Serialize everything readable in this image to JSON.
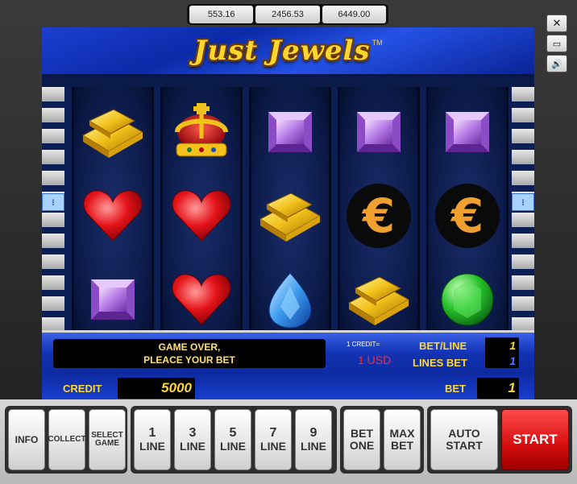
{
  "jackpots": [
    "553.16",
    "2456.53",
    "6449.00"
  ],
  "side_controls": {
    "close": "✕",
    "window": "▭",
    "sound": "🔊"
  },
  "game": {
    "title": "Just Jewels",
    "trademark": "TM",
    "line_indicator": "⁝",
    "reels": [
      [
        "gold-bars",
        "heart",
        "amethyst"
      ],
      [
        "crown",
        "heart",
        "heart"
      ],
      [
        "amethyst",
        "gold-bars",
        "sapphire"
      ],
      [
        "amethyst",
        "euro",
        "gold-bars"
      ],
      [
        "amethyst",
        "euro",
        "emerald"
      ]
    ]
  },
  "panel": {
    "message_line1": "GAME OVER,",
    "message_line2": "PLEACE YOUR BET",
    "credit_rate_label": "1 CREDIT=",
    "credit_rate_value": "1 USD",
    "bet_line_label": "BET/LINE",
    "bet_line_value": "1",
    "lines_bet_label": "LINES BET",
    "lines_bet_value": "1",
    "credit_label": "CREDIT",
    "credit_value": "5000",
    "bet_label": "BET",
    "bet_value": "1"
  },
  "buttons": {
    "info": "INFO",
    "collect": "COLLECT",
    "select_game_1": "SELECT",
    "select_game_2": "GAME",
    "line1_n": "1",
    "line3_n": "3",
    "line5_n": "5",
    "line7_n": "7",
    "line9_n": "9",
    "line_label": "LINE",
    "bet_one_1": "BET",
    "bet_one_2": "ONE",
    "max_bet_1": "MAX",
    "max_bet_2": "BET",
    "auto_start_1": "AUTO",
    "auto_start_2": "START",
    "start": "START"
  }
}
